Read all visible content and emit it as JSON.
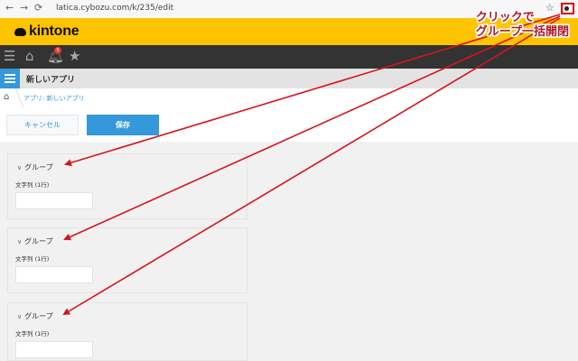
{
  "browser": {
    "url": "latica.cybozu.com/k/235/edit",
    "back_icon": "arrow-left-icon",
    "forward_icon": "arrow-right-icon",
    "reload_icon": "reload-icon",
    "bookmark_icon": "star-icon",
    "extension_icon": "toggle-icon"
  },
  "header": {
    "logo_text": "kintone"
  },
  "appbar": {
    "icons": [
      "menu-icon",
      "home-icon",
      "bell-icon",
      "star-icon"
    ],
    "notification_count": "5"
  },
  "app": {
    "title": "新しいアプリ",
    "breadcrumb": "アプリ: 新しいアプリ"
  },
  "actions": {
    "cancel_label": "キャンセル",
    "save_label": "保存"
  },
  "groups": [
    {
      "label": "グループ",
      "field_label": "文字列 (1行)",
      "field_value": ""
    },
    {
      "label": "グループ",
      "field_label": "文字列 (1行)",
      "field_value": ""
    },
    {
      "label": "グループ",
      "field_label": "文字列 (1行)",
      "field_value": ""
    }
  ],
  "annotation": {
    "line1": "クリックで",
    "line2": "グループ一括開閉",
    "color": "#b0182a",
    "arrow_color": "#d7141e"
  },
  "colors": {
    "header_yellow": "#ffc400",
    "accent_blue": "#3498db",
    "appbar_dark": "#333333"
  }
}
